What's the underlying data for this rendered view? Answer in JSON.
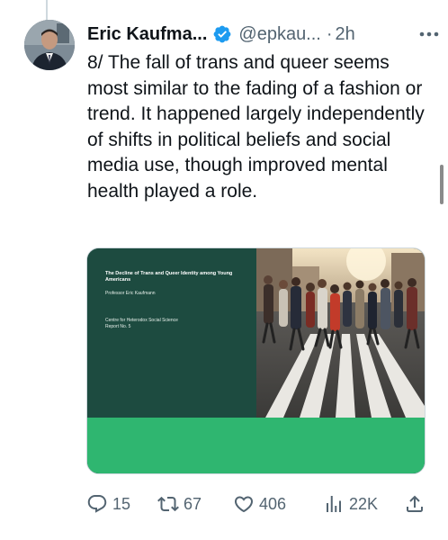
{
  "tweet": {
    "display_name": "Eric Kaufma...",
    "handle": "@epkau...",
    "separator": "·",
    "time": "2h",
    "text": "8/ The fall of trans and queer seems most similar to the fading of a fashion or trend. It happened largely independently of shifts in political beliefs and social media use, though improved mental health played a role."
  },
  "media": {
    "cover_title": "The Decline of Trans and Queer Identity among Young Americans",
    "cover_author": "Professor Eric Kaufmann",
    "cover_centre_line1": "Centre for Heterodox Social Science",
    "cover_centre_line2": "Report No. 5"
  },
  "actions": {
    "replies": "15",
    "reposts": "67",
    "likes": "406",
    "views": "22K"
  },
  "colors": {
    "verified": "#1d9bf0",
    "secondary_text": "#536471",
    "cover_green_dark": "#1d4b40",
    "cover_green_light": "#2fb670"
  },
  "icons": [
    "verified-badge-icon",
    "more-icon",
    "reply-icon",
    "repost-icon",
    "like-icon",
    "views-icon",
    "share-icon"
  ]
}
